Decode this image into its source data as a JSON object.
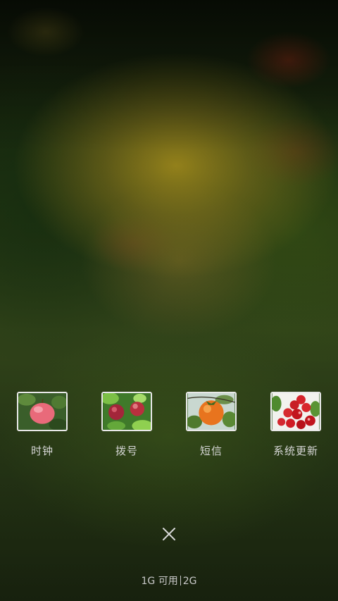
{
  "recent_apps": [
    {
      "label": "时钟",
      "thumbnail_icon": "apple-icon"
    },
    {
      "label": "拨号",
      "thumbnail_icon": "peaches-icon"
    },
    {
      "label": "短信",
      "thumbnail_icon": "persimmon-icon"
    },
    {
      "label": "系统更新",
      "thumbnail_icon": "cherries-icon"
    }
  ],
  "close_button": {
    "icon": "close-icon"
  },
  "memory": {
    "available": "1G 可用",
    "total": "2G"
  }
}
